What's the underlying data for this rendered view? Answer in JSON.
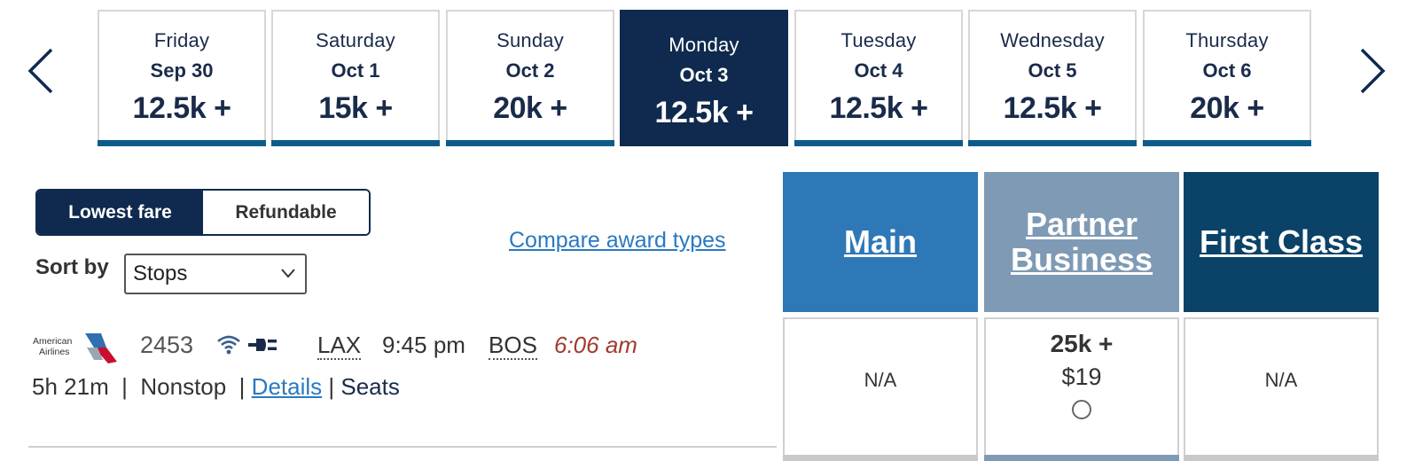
{
  "dates": [
    {
      "day": "Friday",
      "date": "Sep 30",
      "fare": "12.5k +"
    },
    {
      "day": "Saturday",
      "date": "Oct 1",
      "fare": "15k +"
    },
    {
      "day": "Sunday",
      "date": "Oct 2",
      "fare": "20k +"
    },
    {
      "day": "Monday",
      "date": "Oct 3",
      "fare": "12.5k +",
      "selected": true
    },
    {
      "day": "Tuesday",
      "date": "Oct 4",
      "fare": "12.5k +"
    },
    {
      "day": "Wednesday",
      "date": "Oct 5",
      "fare": "12.5k +"
    },
    {
      "day": "Thursday",
      "date": "Oct 6",
      "fare": "20k +"
    }
  ],
  "toggle": {
    "lowest": "Lowest fare",
    "refundable": "Refundable"
  },
  "sort": {
    "label": "Sort by",
    "value": "Stops"
  },
  "compare_link": "Compare award types",
  "classes": {
    "main": "Main",
    "partner": "Partner Business",
    "first": "First Class"
  },
  "flight": {
    "airline_logo_text": "American Airlines",
    "number": "2453",
    "origin": "LAX",
    "departure": "9:45 pm",
    "destination": "BOS",
    "arrival": "6:06 am",
    "duration": "5h 21m",
    "stops": "Nonstop",
    "details_link": "Details",
    "seats_link": "Seats"
  },
  "prices": {
    "main": "N/A",
    "partner_miles": "25k +",
    "partner_cash": "$19",
    "first": "N/A"
  },
  "colors": {
    "navy": "#0f2a4e",
    "main_header": "#2e78b7",
    "partner_header": "#7f9ab5",
    "first_header": "#0a4268",
    "link": "#2a79c0",
    "arrival_time": "#a23a2f"
  }
}
